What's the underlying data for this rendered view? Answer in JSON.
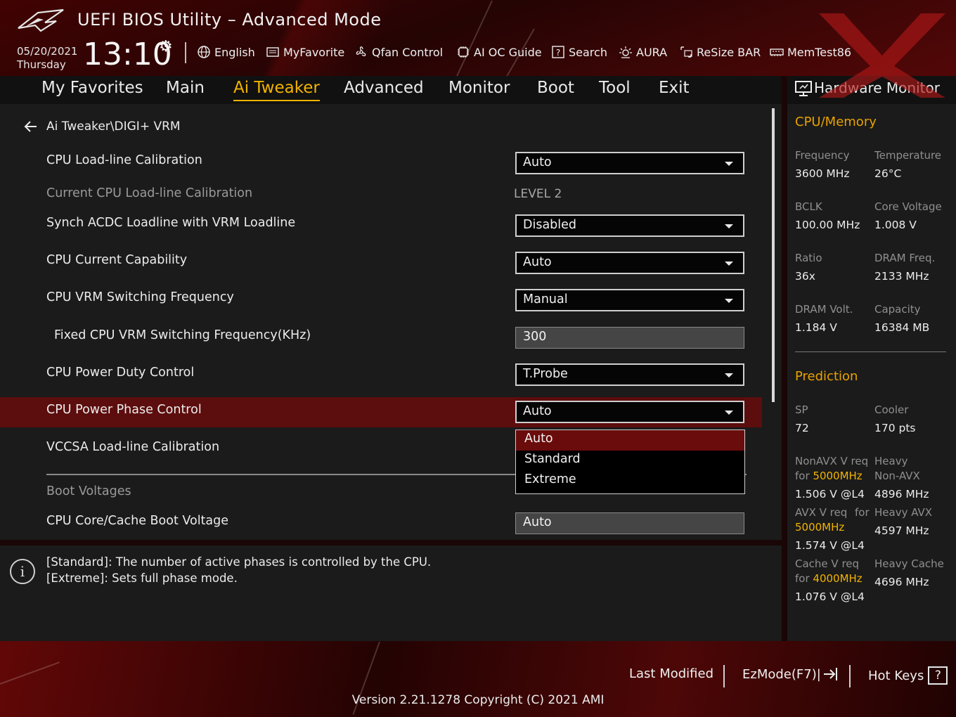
{
  "header": {
    "title": "UEFI BIOS Utility – Advanced Mode",
    "date": "05/20/2021",
    "weekday": "Thursday",
    "time": "13:10",
    "tools": [
      {
        "label": "English",
        "icon": "globe-icon"
      },
      {
        "label": "MyFavorite",
        "icon": "favorite-list-icon"
      },
      {
        "label": "Qfan Control",
        "icon": "fan-icon"
      },
      {
        "label": "AI OC Guide",
        "icon": "ai-chip-icon"
      },
      {
        "label": "Search",
        "icon": "question-box-icon"
      },
      {
        "label": "AURA",
        "icon": "aura-light-icon"
      },
      {
        "label": "ReSize BAR",
        "icon": "resize-bar-icon"
      },
      {
        "label": "MemTest86",
        "icon": "memory-icon"
      }
    ]
  },
  "nav": {
    "tabs": [
      "My Favorites",
      "Main",
      "Ai Tweaker",
      "Advanced",
      "Monitor",
      "Boot",
      "Tool",
      "Exit"
    ],
    "active": "Ai Tweaker"
  },
  "main": {
    "breadcrumb": "Ai Tweaker\\DIGI+ VRM",
    "settings": [
      {
        "label": "CPU Load-line Calibration",
        "value": "Auto",
        "kind": "select"
      },
      {
        "label": "Current CPU Load-line Calibration",
        "value": "LEVEL 2",
        "kind": "readonly"
      },
      {
        "label": "Synch ACDC Loadline with VRM Loadline",
        "value": "Disabled",
        "kind": "select"
      },
      {
        "label": "CPU Current Capability",
        "value": "Auto",
        "kind": "select"
      },
      {
        "label": "CPU VRM Switching Frequency",
        "value": "Manual",
        "kind": "select"
      },
      {
        "label": "Fixed CPU VRM Switching Frequency(KHz)",
        "value": "300",
        "kind": "input"
      },
      {
        "label": "CPU Power Duty Control",
        "value": "T.Probe",
        "kind": "select"
      },
      {
        "label": "CPU Power Phase Control",
        "value": "Auto",
        "kind": "select"
      },
      {
        "label": "VCCSA Load-line Calibration",
        "value": "",
        "kind": "select"
      },
      {
        "label": "CPU Core/Cache Boot Voltage",
        "value": "Auto",
        "kind": "input"
      }
    ],
    "section_boot_voltages": "Boot Voltages",
    "dropdown_options": [
      "Auto",
      "Standard",
      "Extreme"
    ],
    "dropdown_selected": "Auto"
  },
  "help": {
    "lines": [
      "[Standard]: The number of active phases is controlled by the CPU.",
      "[Extreme]: Sets full phase mode."
    ]
  },
  "hardware_monitor": {
    "title": "Hardware Monitor",
    "cpu_memory": {
      "heading": "CPU/Memory",
      "items": [
        {
          "label": "Frequency",
          "value": "3600 MHz"
        },
        {
          "label": "Temperature",
          "value": "26°C"
        },
        {
          "label": "BCLK",
          "value": "100.00 MHz"
        },
        {
          "label": "Core Voltage",
          "value": "1.008 V"
        },
        {
          "label": "Ratio",
          "value": "36x"
        },
        {
          "label": "DRAM Freq.",
          "value": "2133 MHz"
        },
        {
          "label": "DRAM Volt.",
          "value": "1.184 V"
        },
        {
          "label": "Capacity",
          "value": "16384 MB"
        }
      ]
    },
    "prediction": {
      "heading": "Prediction",
      "sp_label": "SP",
      "sp_value": "72",
      "cooler_label": "Cooler",
      "cooler_value": "170 pts",
      "nonavx_label1": "NonAVX V req",
      "nonavx_for": "for",
      "nonavx_freq": "5000MHz",
      "nonavx_value": "1.506 V @L4",
      "heavy_nonavx_label1": "Heavy",
      "heavy_nonavx_label2": "Non-AVX",
      "heavy_nonavx_value": "4896 MHz",
      "avx_label": "AVX V req",
      "avx_for": "for",
      "avx_freq": "5000MHz",
      "avx_value": "1.574 V @L4",
      "heavy_avx_label": "Heavy AVX",
      "heavy_avx_value": "4597 MHz",
      "cache_label": "Cache V req",
      "cache_for": "for",
      "cache_freq": "4000MHz",
      "cache_value": "1.076 V @L4",
      "heavy_cache_label": "Heavy Cache",
      "heavy_cache_value": "4696 MHz"
    }
  },
  "footer": {
    "last_modified": "Last Modified",
    "ezmode": "EzMode(F7)|",
    "hot_keys": "Hot Keys",
    "hot_keys_glyph": "?",
    "version": "Version 2.21.1278 Copyright (C) 2021 AMI"
  },
  "colors": {
    "accent": "#f2b300",
    "highlight_row": "#5c0d0d",
    "section_heading": "#e8a200"
  }
}
